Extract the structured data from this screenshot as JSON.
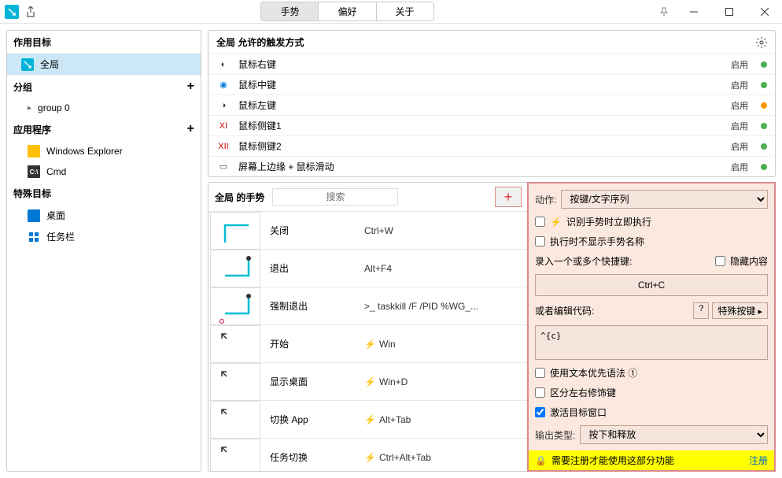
{
  "tabs": {
    "gestures": "手势",
    "preferences": "偏好",
    "about": "关于"
  },
  "sidebar": {
    "targets_header": "作用目标",
    "global": "全局",
    "groups_header": "分组",
    "group0": "group 0",
    "apps_header": "应用程序",
    "explorer": "Windows Explorer",
    "cmd": "Cmd",
    "special_header": "特殊目标",
    "desktop": "桌面",
    "taskbar": "任务栏"
  },
  "triggers": {
    "header": "全局 允许的触发方式",
    "items": [
      {
        "icon": "◐",
        "name": "鼠标右键",
        "status": "启用",
        "dot": "green"
      },
      {
        "icon": "◉",
        "name": "鼠标中键",
        "status": "启用",
        "dot": "green"
      },
      {
        "icon": "◑",
        "name": "鼠标左键",
        "status": "启用",
        "dot": "yellow"
      },
      {
        "icon": "XI",
        "name": "鼠标侧键1",
        "status": "启用",
        "dot": "green"
      },
      {
        "icon": "XII",
        "name": "鼠标侧键2",
        "status": "启用",
        "dot": "green"
      },
      {
        "icon": "▭",
        "name": "屏幕上边缘 + 鼠标滑动",
        "status": "启用",
        "dot": "green"
      }
    ]
  },
  "gestures": {
    "header": "全局 的手势",
    "search_placeholder": "搜索",
    "items": [
      {
        "name": "关闭",
        "shortcut": "Ctrl+W",
        "icon": ""
      },
      {
        "name": "退出",
        "shortcut": "Alt+F4",
        "icon": ""
      },
      {
        "name": "强制退出",
        "shortcut": ">_ taskkill /F /PID %WG_...",
        "icon": ""
      },
      {
        "name": "开始",
        "shortcut": "Win",
        "icon": "bolt"
      },
      {
        "name": "显示桌面",
        "shortcut": "Win+D",
        "icon": "bolt"
      },
      {
        "name": "切换 App",
        "shortcut": "Alt+Tab",
        "icon": "bolt"
      },
      {
        "name": "任务切换",
        "shortcut": "Ctrl+Alt+Tab",
        "icon": "bolt"
      }
    ]
  },
  "panel": {
    "action_label": "动作:",
    "action_value": "按键/文字序列",
    "recognize_immediately": "识别手势时立即执行",
    "hide_name": "执行时不显示手势名称",
    "record_shortcuts": "录入一个或多个快捷键:",
    "hide_content": "隐藏内容",
    "shortcut_value": "Ctrl+C",
    "or_edit_code": "或者编辑代码:",
    "help": "?",
    "special_keys": "特殊按键",
    "code_value": "^{c}",
    "use_text_syntax": "使用文本优先语法 ①",
    "distinguish_modifiers": "区分左右修饰键",
    "activate_window": "激活目标窗口",
    "output_type_label": "输出类型:",
    "output_type_value": "按下和释放",
    "register_msg": "需要注册才能使用这部分功能",
    "register_link": "注册"
  }
}
